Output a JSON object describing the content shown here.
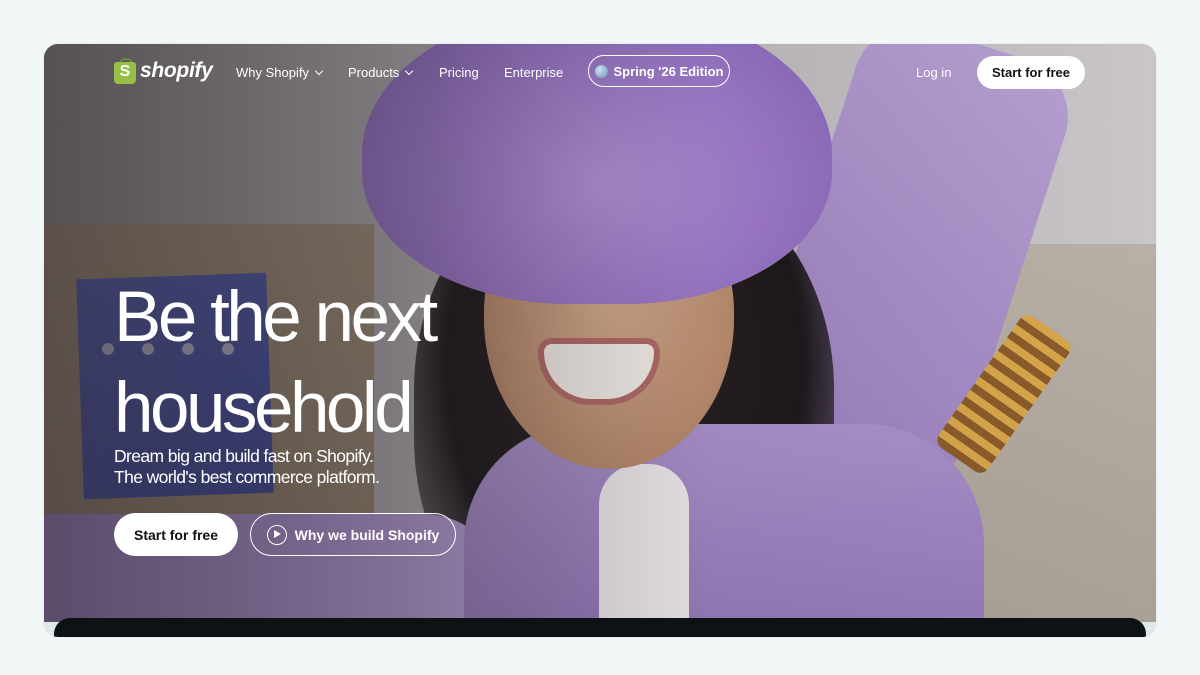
{
  "nav": {
    "logo_text": "shopify",
    "logo_icon": "shopify-bag-icon",
    "items": [
      {
        "label": "Why Shopify",
        "has_dropdown": true
      },
      {
        "label": "Products",
        "has_dropdown": true
      },
      {
        "label": "Pricing",
        "has_dropdown": false
      },
      {
        "label": "Enterprise",
        "has_dropdown": false
      }
    ],
    "edition_label": "Spring '26 Edition",
    "edition_icon": "globe-icon",
    "login_label": "Log in",
    "start_label": "Start for free"
  },
  "hero": {
    "headline": "Be the next household",
    "subline_1": "Dream big and build fast on Shopify.",
    "subline_2": "The world's best commerce platform.",
    "primary_cta": "Start for free",
    "secondary_cta": "Why we build Shopify",
    "secondary_icon": "play-circle-icon",
    "background": "video-still-woman-purple-hat"
  },
  "colors": {
    "page_bg": "#f1f6f7",
    "logo_green": "#95bf47",
    "button_bg": "#ffffff",
    "text_on_hero": "#ffffff"
  }
}
